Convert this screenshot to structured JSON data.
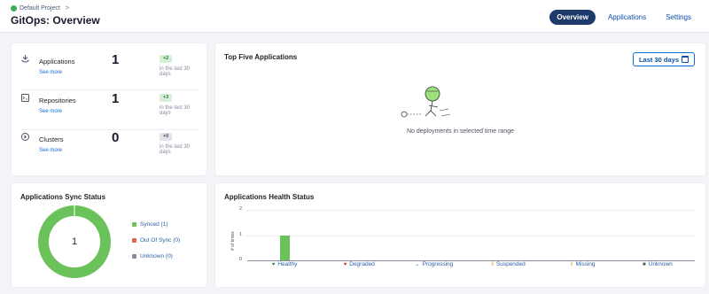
{
  "header": {
    "breadcrumb": "Default Project",
    "breadcrumb_sep": ">",
    "title": "GitOps: Overview",
    "tabs": [
      {
        "label": "Overview",
        "active": true
      },
      {
        "label": "Applications",
        "active": false
      },
      {
        "label": "Settings",
        "active": false
      }
    ]
  },
  "stats": [
    {
      "label": "Applications",
      "value": "1",
      "delta": "+2",
      "period": "in the last 30 days",
      "see_more": "See more",
      "icon": "app-icon"
    },
    {
      "label": "Repositories",
      "value": "1",
      "delta": "+3",
      "period": "in the last 30 days",
      "see_more": "See more",
      "icon": "repo-icon"
    },
    {
      "label": "Clusters",
      "value": "0",
      "delta": "+0",
      "period": "in the last 30 days",
      "see_more": "See more",
      "icon": "cluster-icon"
    }
  ],
  "top_five": {
    "title": "Top Five Applications",
    "range_button": "Last 30 days",
    "empty_message": "No deployments in selected time range"
  },
  "sync_status": {
    "title": "Applications Sync Status",
    "total": "1",
    "legend": [
      {
        "label": "Synced (1)",
        "value": 1,
        "color": "#6cc25a"
      },
      {
        "label": "Out Of Sync (0)",
        "value": 0,
        "color": "#e0654a"
      },
      {
        "label": "Unknown (0)",
        "value": 0,
        "color": "#8a8c97"
      }
    ]
  },
  "health_status": {
    "title": "Applications Health Status",
    "chart_data": {
      "type": "bar",
      "categories": [
        "Healthy",
        "Degraded",
        "Progressing",
        "Suspended",
        "Missing",
        "Unknown"
      ],
      "values": [
        1,
        0,
        0,
        0,
        0,
        0
      ],
      "ylabel": "# of times",
      "ylim": [
        0,
        2
      ],
      "yticks": [
        "0",
        "1",
        "2"
      ],
      "bar_color": "#6cc25a",
      "category_icons": [
        "heart-icon",
        "broken-heart-icon",
        "arrow-right-icon",
        "pause-icon",
        "warning-icon",
        "unknown-icon"
      ]
    }
  }
}
